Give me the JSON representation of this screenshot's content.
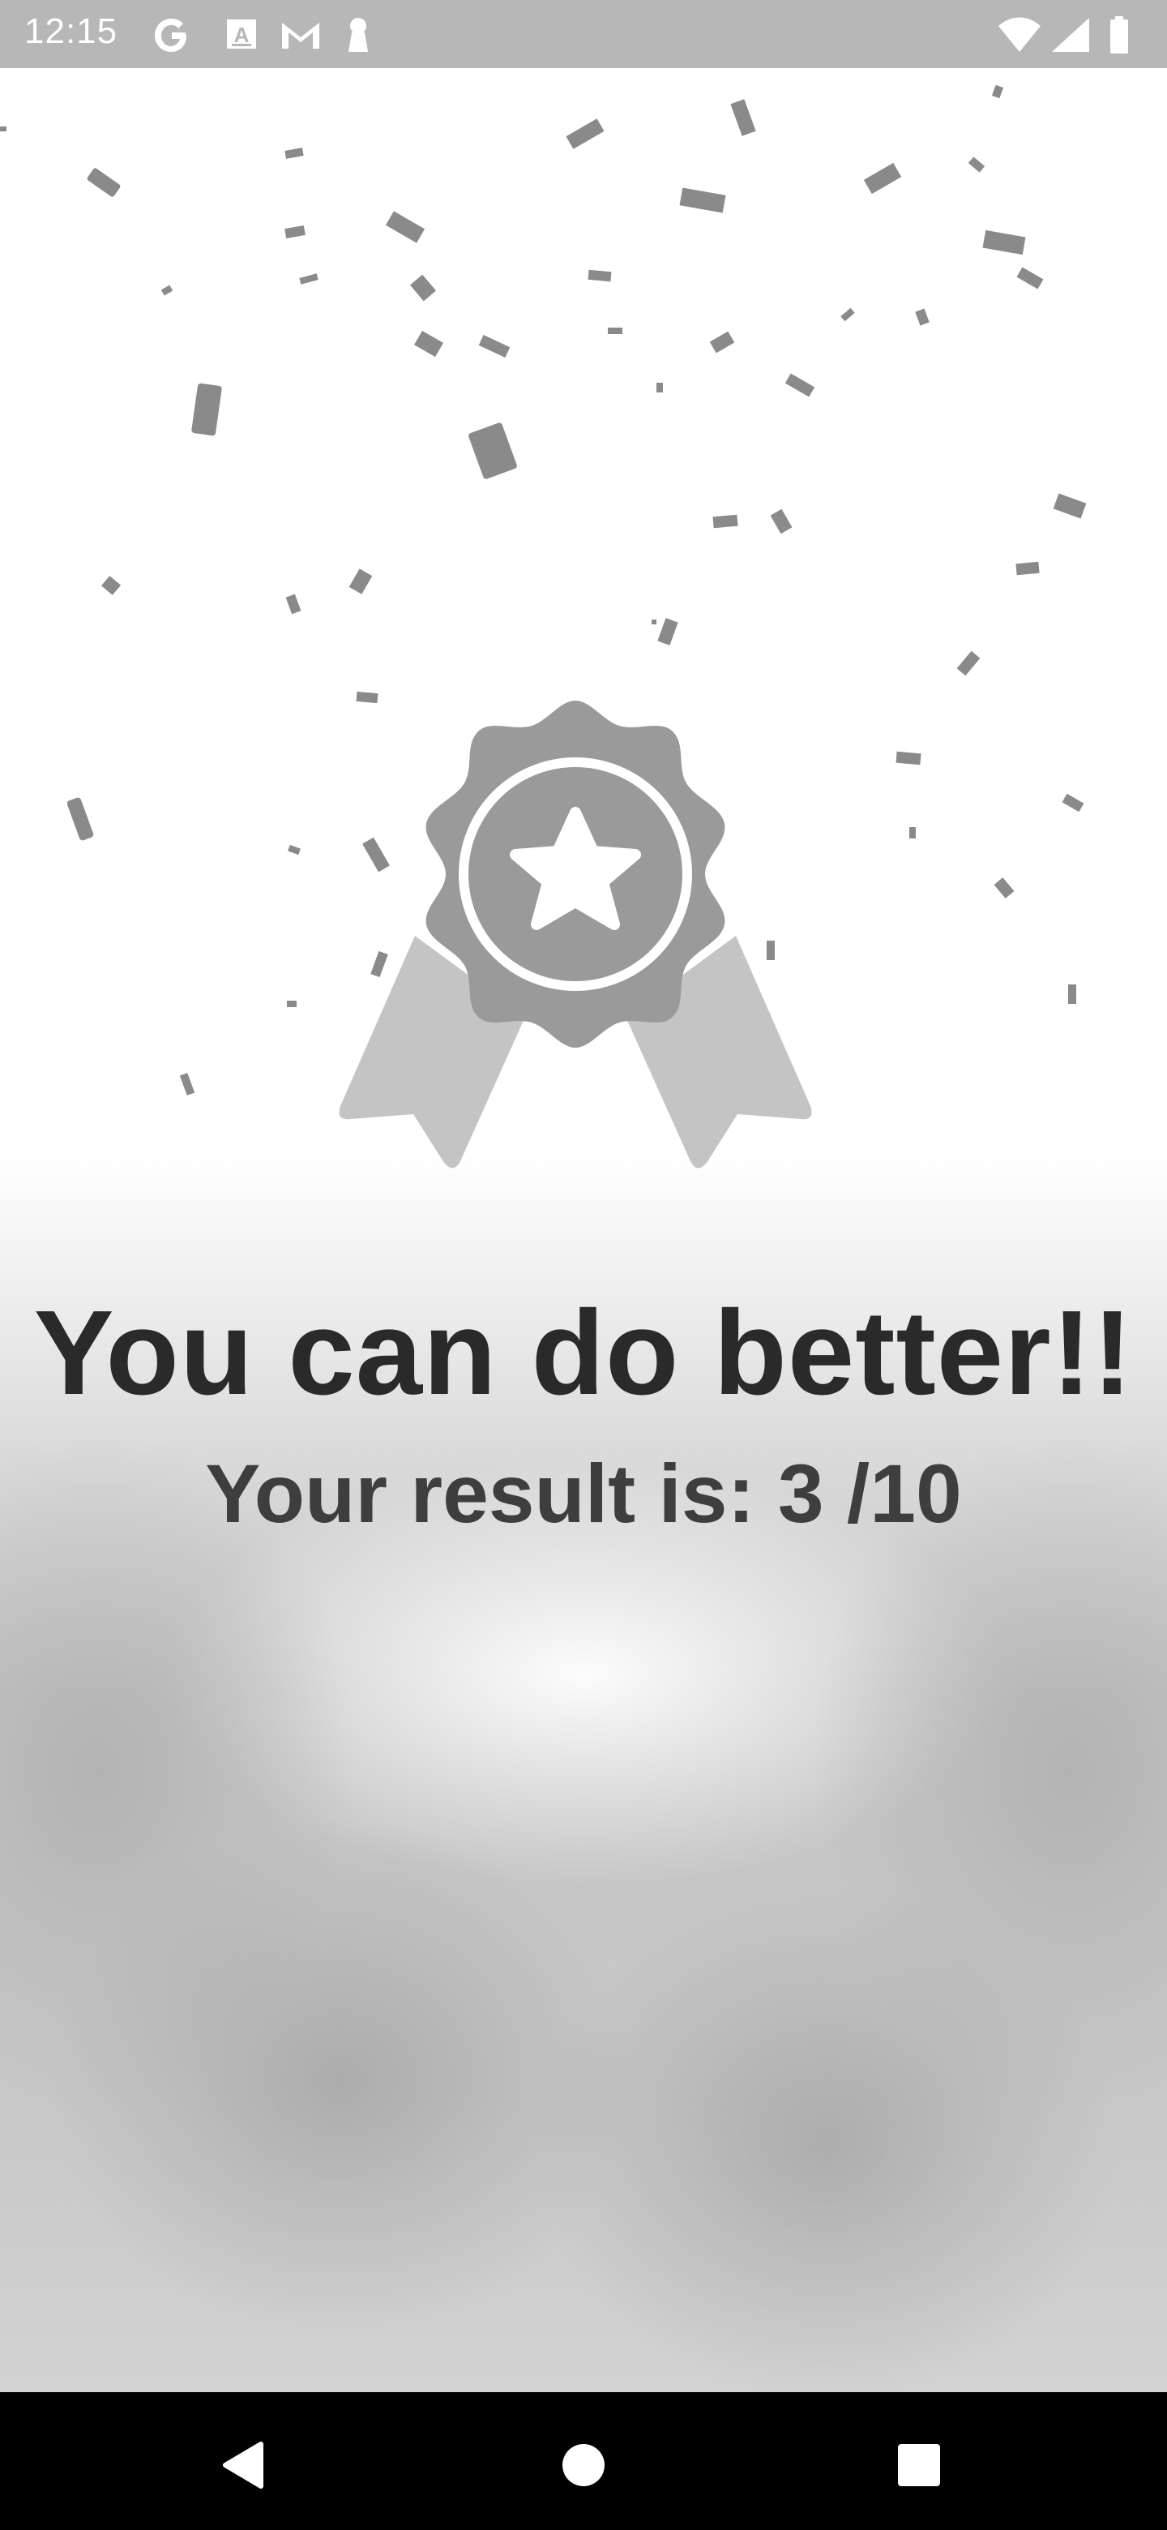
{
  "status_bar": {
    "time": "12:15",
    "left_icons": [
      "google-icon",
      "accessibility-font-icon",
      "gmail-icon",
      "keyhole-icon"
    ],
    "right_icons": [
      "wifi-icon",
      "cellular-signal-icon",
      "battery-icon"
    ]
  },
  "result_screen": {
    "badge_icon": "award-ribbon-star-icon",
    "headline": "You can do better!!",
    "result_text": "Your result is: 3 /10"
  },
  "navigation_bar": {
    "buttons": [
      "back-icon",
      "home-icon",
      "recents-icon"
    ]
  },
  "colors": {
    "status_bar": "#b7b7b7",
    "badge": "#9a9a9a",
    "ribbon": "#c4c4c4",
    "headline": "#2a2a2a",
    "result": "#3e3e3e",
    "nav_bar": "#000000"
  }
}
